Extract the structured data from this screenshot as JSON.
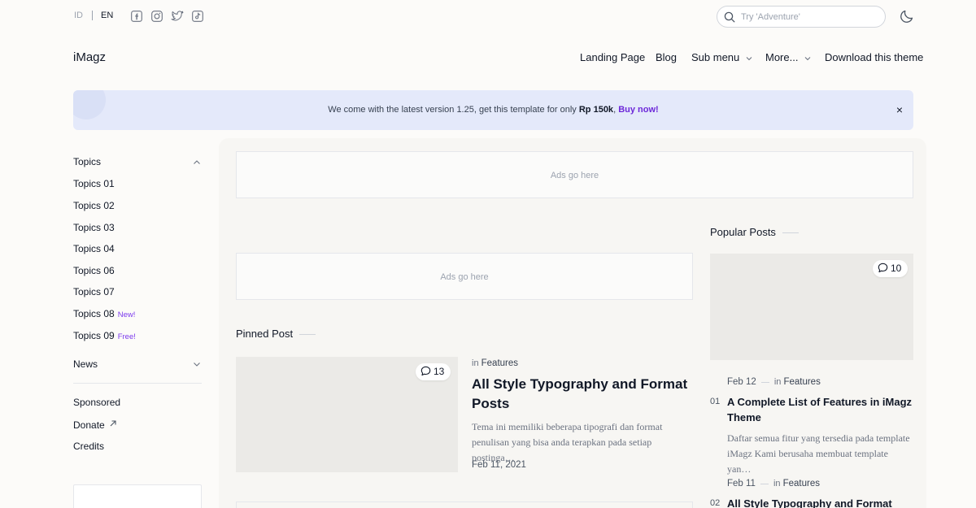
{
  "topbar": {
    "languages": [
      "ID",
      "EN"
    ],
    "search_placeholder": "Try 'Adventure'",
    "social_icons": [
      "facebook-icon",
      "instagram-icon",
      "twitter-icon",
      "tiktok-icon"
    ]
  },
  "header": {
    "logo": "iMagz",
    "nav": [
      "Landing Page",
      "Blog",
      "Sub menu",
      "More...",
      "Download this theme"
    ]
  },
  "banner": {
    "text": "We come with the latest version 1.25, get this template for only ",
    "price": "Rp 150k",
    "separator": ", ",
    "cta": "Buy now!",
    "close": "×"
  },
  "sidebar": {
    "topics_label": "Topics",
    "topics": [
      {
        "label": "Topics 01",
        "badge": ""
      },
      {
        "label": "Topics 02",
        "badge": ""
      },
      {
        "label": "Topics 03",
        "badge": ""
      },
      {
        "label": "Topics 04",
        "badge": ""
      },
      {
        "label": "Topics 06",
        "badge": ""
      },
      {
        "label": "Topics 07",
        "badge": ""
      },
      {
        "label": "Topics 08",
        "badge": "New!"
      },
      {
        "label": "Topics 09",
        "badge": "Free!"
      }
    ],
    "news_label": "News",
    "links": [
      "Sponsored",
      "Donate",
      "Credits"
    ]
  },
  "main": {
    "ads_top": "Ads go here",
    "ads_mid": "Ads go here",
    "pinned_title": "Pinned Post",
    "pinned": {
      "comments": "13",
      "in_label": "in",
      "category": "Features",
      "title": "All Style Typography and Format Posts",
      "excerpt": "Tema ini memiliki beberapa tipografi dan format penulisan yang bisa anda terapkan pada setiap postinga…",
      "date": "Feb 11, 2021"
    },
    "popular_title": "Popular Posts",
    "popular_comments": "10",
    "popular": [
      {
        "num": "01",
        "date": "Feb 12",
        "in_label": "in",
        "category": "Features",
        "title": "A Complete List of Features in iMagz Theme",
        "excerpt": "Daftar semua fitur yang tersedia pada template iMagz Kami berusaha membuat template yan…"
      },
      {
        "num": "02",
        "date": "Feb 11",
        "in_label": "in",
        "category": "Features",
        "title": "All Style Typography and Format"
      }
    ]
  }
}
